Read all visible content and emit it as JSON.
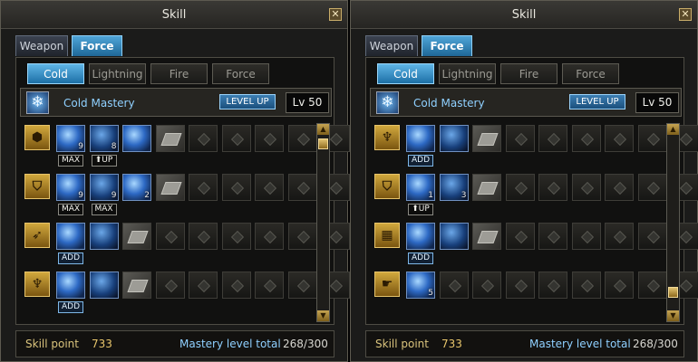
{
  "windows": [
    {
      "title": "Skill",
      "close_glyph": "✕",
      "main_tabs": [
        "Weapon",
        "Force"
      ],
      "sub_tabs": [
        "Cold",
        "Lightning",
        "Fire",
        "Force"
      ],
      "mastery": {
        "name": "Cold Mastery",
        "level_up": "LEVEL UP",
        "level": "Lv 50"
      },
      "rows": [
        {
          "category_icon": "shield-rune-icon",
          "cells": [
            {
              "kind": "skill",
              "badge": "9"
            },
            {
              "kind": "skill",
              "badge": "8"
            },
            {
              "kind": "skill",
              "badge": ""
            },
            {
              "kind": "locked",
              "badge": ""
            },
            {
              "kind": "empty"
            },
            {
              "kind": "empty"
            },
            {
              "kind": "empty"
            },
            {
              "kind": "empty"
            },
            {
              "kind": "empty"
            }
          ],
          "tags": [
            {
              "slot": 0,
              "text": "MAX"
            },
            {
              "slot": 1,
              "text": "⬆UP"
            }
          ]
        },
        {
          "category_icon": "shield-icon",
          "cells": [
            {
              "kind": "skill",
              "badge": "9"
            },
            {
              "kind": "skill",
              "badge": "9"
            },
            {
              "kind": "skill",
              "badge": "2"
            },
            {
              "kind": "locked",
              "badge": ""
            },
            {
              "kind": "empty"
            },
            {
              "kind": "empty"
            },
            {
              "kind": "empty"
            },
            {
              "kind": "empty"
            },
            {
              "kind": "empty"
            }
          ],
          "tags": [
            {
              "slot": 0,
              "text": "MAX"
            },
            {
              "slot": 1,
              "text": "MAX"
            }
          ]
        },
        {
          "category_icon": "comet-icon",
          "cells": [
            {
              "kind": "skill",
              "badge": ""
            },
            {
              "kind": "skill",
              "badge": ""
            },
            {
              "kind": "locked",
              "badge": ""
            },
            {
              "kind": "empty"
            },
            {
              "kind": "empty"
            },
            {
              "kind": "empty"
            },
            {
              "kind": "empty"
            },
            {
              "kind": "empty"
            },
            {
              "kind": "empty"
            }
          ],
          "tags": [
            {
              "slot": 0,
              "text": "ADD"
            }
          ]
        },
        {
          "category_icon": "figure-icon",
          "cells": [
            {
              "kind": "skill",
              "badge": ""
            },
            {
              "kind": "skill",
              "badge": ""
            },
            {
              "kind": "locked",
              "badge": ""
            },
            {
              "kind": "empty"
            },
            {
              "kind": "empty"
            },
            {
              "kind": "empty"
            },
            {
              "kind": "empty"
            },
            {
              "kind": "empty"
            },
            {
              "kind": "empty"
            }
          ],
          "tags": [
            {
              "slot": 0,
              "text": "ADD"
            }
          ]
        }
      ],
      "footer": {
        "skill_point_label": "Skill point",
        "skill_point": "733",
        "mastery_total_label": "Mastery level total",
        "mastery_total": "268/300"
      }
    },
    {
      "title": "Skill",
      "close_glyph": "✕",
      "main_tabs": [
        "Weapon",
        "Force"
      ],
      "sub_tabs": [
        "Cold",
        "Lightning",
        "Fire",
        "Force"
      ],
      "mastery": {
        "name": "Cold Mastery",
        "level_up": "LEVEL UP",
        "level": "Lv 50"
      },
      "rows": [
        {
          "category_icon": "figure-icon",
          "cells": [
            {
              "kind": "skill",
              "badge": ""
            },
            {
              "kind": "skill",
              "badge": ""
            },
            {
              "kind": "locked",
              "badge": ""
            },
            {
              "kind": "empty"
            },
            {
              "kind": "empty"
            },
            {
              "kind": "empty"
            },
            {
              "kind": "empty"
            },
            {
              "kind": "empty"
            },
            {
              "kind": "empty"
            }
          ],
          "tags": [
            {
              "slot": 0,
              "text": "ADD"
            }
          ]
        },
        {
          "category_icon": "shield-icon",
          "cells": [
            {
              "kind": "skill",
              "badge": "1"
            },
            {
              "kind": "skill",
              "badge": "3"
            },
            {
              "kind": "locked",
              "badge": ""
            },
            {
              "kind": "empty"
            },
            {
              "kind": "empty"
            },
            {
              "kind": "empty"
            },
            {
              "kind": "empty"
            },
            {
              "kind": "empty"
            },
            {
              "kind": "empty"
            }
          ],
          "tags": [
            {
              "slot": 0,
              "text": "⬆UP"
            }
          ]
        },
        {
          "category_icon": "sand-icon",
          "cells": [
            {
              "kind": "skill",
              "badge": ""
            },
            {
              "kind": "skill",
              "badge": ""
            },
            {
              "kind": "locked",
              "badge": ""
            },
            {
              "kind": "empty"
            },
            {
              "kind": "empty"
            },
            {
              "kind": "empty"
            },
            {
              "kind": "empty"
            },
            {
              "kind": "empty"
            },
            {
              "kind": "empty"
            }
          ],
          "tags": [
            {
              "slot": 0,
              "text": "ADD"
            }
          ]
        },
        {
          "category_icon": "hand-icon",
          "cells": [
            {
              "kind": "skill",
              "badge": "5"
            },
            {
              "kind": "empty"
            },
            {
              "kind": "empty"
            },
            {
              "kind": "empty"
            },
            {
              "kind": "empty"
            },
            {
              "kind": "empty"
            },
            {
              "kind": "empty"
            },
            {
              "kind": "empty"
            },
            {
              "kind": "empty"
            }
          ],
          "tags": []
        }
      ],
      "footer": {
        "skill_point_label": "Skill point",
        "skill_point": "733",
        "mastery_total_label": "Mastery level total",
        "mastery_total": "268/300"
      }
    }
  ]
}
